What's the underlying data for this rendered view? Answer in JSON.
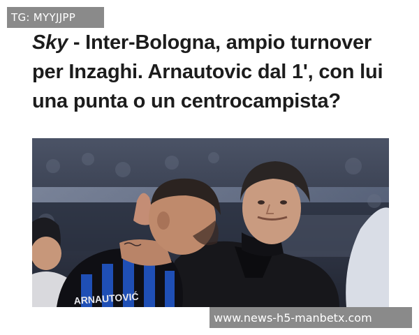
{
  "badge": {
    "text": "TG: MYYJJPP"
  },
  "article": {
    "source": "Sky",
    "title_rest": " - Inter-Bologna, ampio turnover per Inzaghi. Arnautovic dal 1', con lui una punta o un centrocampista?"
  },
  "photo": {
    "jersey_lettering": "ARNAUTOVIĆ",
    "colors": {
      "jersey_blue": "#1f4fb5",
      "jersey_black": "#0f0f14",
      "stadium_bg": "#3b4150"
    }
  },
  "watermark": {
    "text": "www.news-h5-manbetx.com"
  }
}
